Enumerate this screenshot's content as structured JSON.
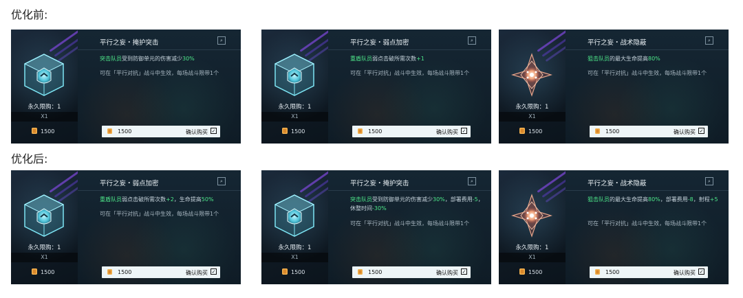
{
  "sections": [
    {
      "label": "优化前:",
      "cards": [
        {
          "art": "cube-shield-icon",
          "title": "平行之妄・掩护突击",
          "effect_parts": [
            {
              "text": "突击队员",
              "hl": true
            },
            {
              "text": "受到防御单元的伤害减少",
              "hl": false
            },
            {
              "text": "30%",
              "hl": true
            }
          ],
          "note": "可在「平行对抗」战斗中生效，每场战斗限带1个",
          "limit": "永久限购：1",
          "qty": "X1",
          "price": "1500",
          "confirm": "确认购买"
        },
        {
          "art": "cube-shield-icon",
          "title": "平行之妄・弱点加密",
          "effect_parts": [
            {
              "text": "重盾队员",
              "hl": true
            },
            {
              "text": "弱点击破所需次数",
              "hl": false
            },
            {
              "text": "+1",
              "hl": true
            }
          ],
          "note": "可在「平行对抗」战斗中生效，每场战斗限带1个",
          "limit": "永久限购：1",
          "qty": "X1",
          "price": "1500",
          "confirm": "确认购买"
        },
        {
          "art": "crystal-star-icon",
          "title": "平行之妄・战术隐蔽",
          "effect_parts": [
            {
              "text": "狙击队员",
              "hl": true
            },
            {
              "text": "的最大生命提高",
              "hl": false
            },
            {
              "text": "80%",
              "hl": true
            }
          ],
          "note": "可在「平行对抗」战斗中生效，每场战斗限带1个",
          "limit": "永久限购：1",
          "qty": "X1",
          "price": "1500",
          "confirm": "确认购买"
        }
      ]
    },
    {
      "label": "优化后:",
      "cards": [
        {
          "art": "cube-shield-icon",
          "title": "平行之妄・弱点加密",
          "effect_parts": [
            {
              "text": "重盾队员",
              "hl": true
            },
            {
              "text": "弱点击破所需次数",
              "hl": false
            },
            {
              "text": "+2",
              "hl": true
            },
            {
              "text": "，生命提高",
              "hl": false
            },
            {
              "text": "50%",
              "hl": true
            }
          ],
          "note": "可在「平行对抗」战斗中生效，每场战斗限带1个",
          "limit": "永久限购：1",
          "qty": "X1",
          "price": "1500",
          "confirm": "确认购买"
        },
        {
          "art": "cube-shield-icon",
          "title": "平行之妄・掩护突击",
          "effect_parts": [
            {
              "text": "突击队员",
              "hl": true
            },
            {
              "text": "受到防御单元的伤害减少",
              "hl": false
            },
            {
              "text": "30%",
              "hl": true
            },
            {
              "text": "，部署费用",
              "hl": false
            },
            {
              "text": "-5",
              "hl": true
            },
            {
              "text": "，休整时间",
              "hl": false
            },
            {
              "text": "-30%",
              "hl": true
            }
          ],
          "note": "可在「平行对抗」战斗中生效，每场战斗限带1个",
          "limit": "永久限购：1",
          "qty": "X1",
          "price": "1500",
          "confirm": "确认购买"
        },
        {
          "art": "crystal-star-icon",
          "title": "平行之妄・战术隐蔽",
          "effect_parts": [
            {
              "text": "狙击队员",
              "hl": true
            },
            {
              "text": "的最大生命提高",
              "hl": false
            },
            {
              "text": "80%",
              "hl": true
            },
            {
              "text": "，部署费用",
              "hl": false
            },
            {
              "text": "-8",
              "hl": true
            },
            {
              "text": "，射程",
              "hl": false
            },
            {
              "text": "+5",
              "hl": true
            }
          ],
          "note": "可在「平行对抗」战斗中生效，每场战斗限带1个",
          "limit": "永久限购：1",
          "qty": "X1",
          "price": "1500",
          "confirm": "确认购买"
        }
      ]
    }
  ]
}
